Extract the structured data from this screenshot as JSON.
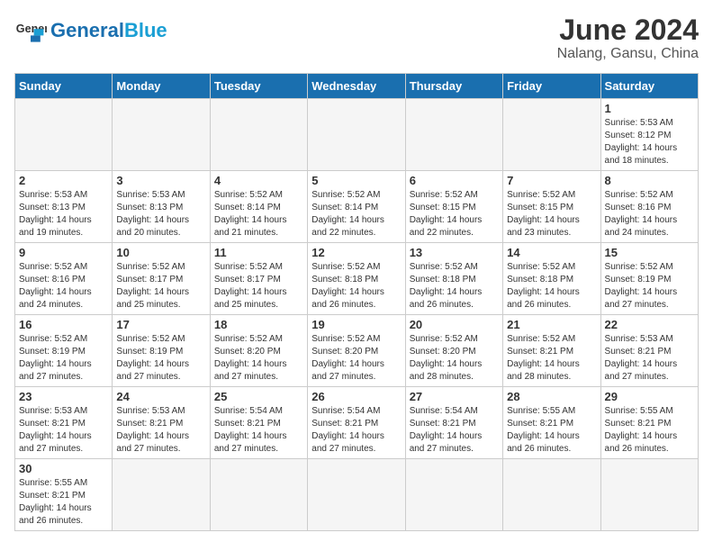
{
  "header": {
    "logo_general": "General",
    "logo_blue": "Blue",
    "title": "June 2024",
    "subtitle": "Nalang, Gansu, China"
  },
  "days_of_week": [
    "Sunday",
    "Monday",
    "Tuesday",
    "Wednesday",
    "Thursday",
    "Friday",
    "Saturday"
  ],
  "weeks": [
    [
      {
        "day": "",
        "info": ""
      },
      {
        "day": "",
        "info": ""
      },
      {
        "day": "",
        "info": ""
      },
      {
        "day": "",
        "info": ""
      },
      {
        "day": "",
        "info": ""
      },
      {
        "day": "",
        "info": ""
      },
      {
        "day": "1",
        "info": "Sunrise: 5:53 AM\nSunset: 8:12 PM\nDaylight: 14 hours and 18 minutes."
      }
    ],
    [
      {
        "day": "2",
        "info": "Sunrise: 5:53 AM\nSunset: 8:13 PM\nDaylight: 14 hours and 19 minutes."
      },
      {
        "day": "3",
        "info": "Sunrise: 5:53 AM\nSunset: 8:13 PM\nDaylight: 14 hours and 20 minutes."
      },
      {
        "day": "4",
        "info": "Sunrise: 5:52 AM\nSunset: 8:14 PM\nDaylight: 14 hours and 21 minutes."
      },
      {
        "day": "5",
        "info": "Sunrise: 5:52 AM\nSunset: 8:14 PM\nDaylight: 14 hours and 22 minutes."
      },
      {
        "day": "6",
        "info": "Sunrise: 5:52 AM\nSunset: 8:15 PM\nDaylight: 14 hours and 22 minutes."
      },
      {
        "day": "7",
        "info": "Sunrise: 5:52 AM\nSunset: 8:15 PM\nDaylight: 14 hours and 23 minutes."
      },
      {
        "day": "8",
        "info": "Sunrise: 5:52 AM\nSunset: 8:16 PM\nDaylight: 14 hours and 24 minutes."
      }
    ],
    [
      {
        "day": "9",
        "info": "Sunrise: 5:52 AM\nSunset: 8:16 PM\nDaylight: 14 hours and 24 minutes."
      },
      {
        "day": "10",
        "info": "Sunrise: 5:52 AM\nSunset: 8:17 PM\nDaylight: 14 hours and 25 minutes."
      },
      {
        "day": "11",
        "info": "Sunrise: 5:52 AM\nSunset: 8:17 PM\nDaylight: 14 hours and 25 minutes."
      },
      {
        "day": "12",
        "info": "Sunrise: 5:52 AM\nSunset: 8:18 PM\nDaylight: 14 hours and 26 minutes."
      },
      {
        "day": "13",
        "info": "Sunrise: 5:52 AM\nSunset: 8:18 PM\nDaylight: 14 hours and 26 minutes."
      },
      {
        "day": "14",
        "info": "Sunrise: 5:52 AM\nSunset: 8:18 PM\nDaylight: 14 hours and 26 minutes."
      },
      {
        "day": "15",
        "info": "Sunrise: 5:52 AM\nSunset: 8:19 PM\nDaylight: 14 hours and 27 minutes."
      }
    ],
    [
      {
        "day": "16",
        "info": "Sunrise: 5:52 AM\nSunset: 8:19 PM\nDaylight: 14 hours and 27 minutes."
      },
      {
        "day": "17",
        "info": "Sunrise: 5:52 AM\nSunset: 8:19 PM\nDaylight: 14 hours and 27 minutes."
      },
      {
        "day": "18",
        "info": "Sunrise: 5:52 AM\nSunset: 8:20 PM\nDaylight: 14 hours and 27 minutes."
      },
      {
        "day": "19",
        "info": "Sunrise: 5:52 AM\nSunset: 8:20 PM\nDaylight: 14 hours and 27 minutes."
      },
      {
        "day": "20",
        "info": "Sunrise: 5:52 AM\nSunset: 8:20 PM\nDaylight: 14 hours and 28 minutes."
      },
      {
        "day": "21",
        "info": "Sunrise: 5:52 AM\nSunset: 8:21 PM\nDaylight: 14 hours and 28 minutes."
      },
      {
        "day": "22",
        "info": "Sunrise: 5:53 AM\nSunset: 8:21 PM\nDaylight: 14 hours and 27 minutes."
      }
    ],
    [
      {
        "day": "23",
        "info": "Sunrise: 5:53 AM\nSunset: 8:21 PM\nDaylight: 14 hours and 27 minutes."
      },
      {
        "day": "24",
        "info": "Sunrise: 5:53 AM\nSunset: 8:21 PM\nDaylight: 14 hours and 27 minutes."
      },
      {
        "day": "25",
        "info": "Sunrise: 5:54 AM\nSunset: 8:21 PM\nDaylight: 14 hours and 27 minutes."
      },
      {
        "day": "26",
        "info": "Sunrise: 5:54 AM\nSunset: 8:21 PM\nDaylight: 14 hours and 27 minutes."
      },
      {
        "day": "27",
        "info": "Sunrise: 5:54 AM\nSunset: 8:21 PM\nDaylight: 14 hours and 27 minutes."
      },
      {
        "day": "28",
        "info": "Sunrise: 5:55 AM\nSunset: 8:21 PM\nDaylight: 14 hours and 26 minutes."
      },
      {
        "day": "29",
        "info": "Sunrise: 5:55 AM\nSunset: 8:21 PM\nDaylight: 14 hours and 26 minutes."
      }
    ],
    [
      {
        "day": "30",
        "info": "Sunrise: 5:55 AM\nSunset: 8:21 PM\nDaylight: 14 hours and 26 minutes."
      },
      {
        "day": "",
        "info": ""
      },
      {
        "day": "",
        "info": ""
      },
      {
        "day": "",
        "info": ""
      },
      {
        "day": "",
        "info": ""
      },
      {
        "day": "",
        "info": ""
      },
      {
        "day": "",
        "info": ""
      }
    ]
  ]
}
